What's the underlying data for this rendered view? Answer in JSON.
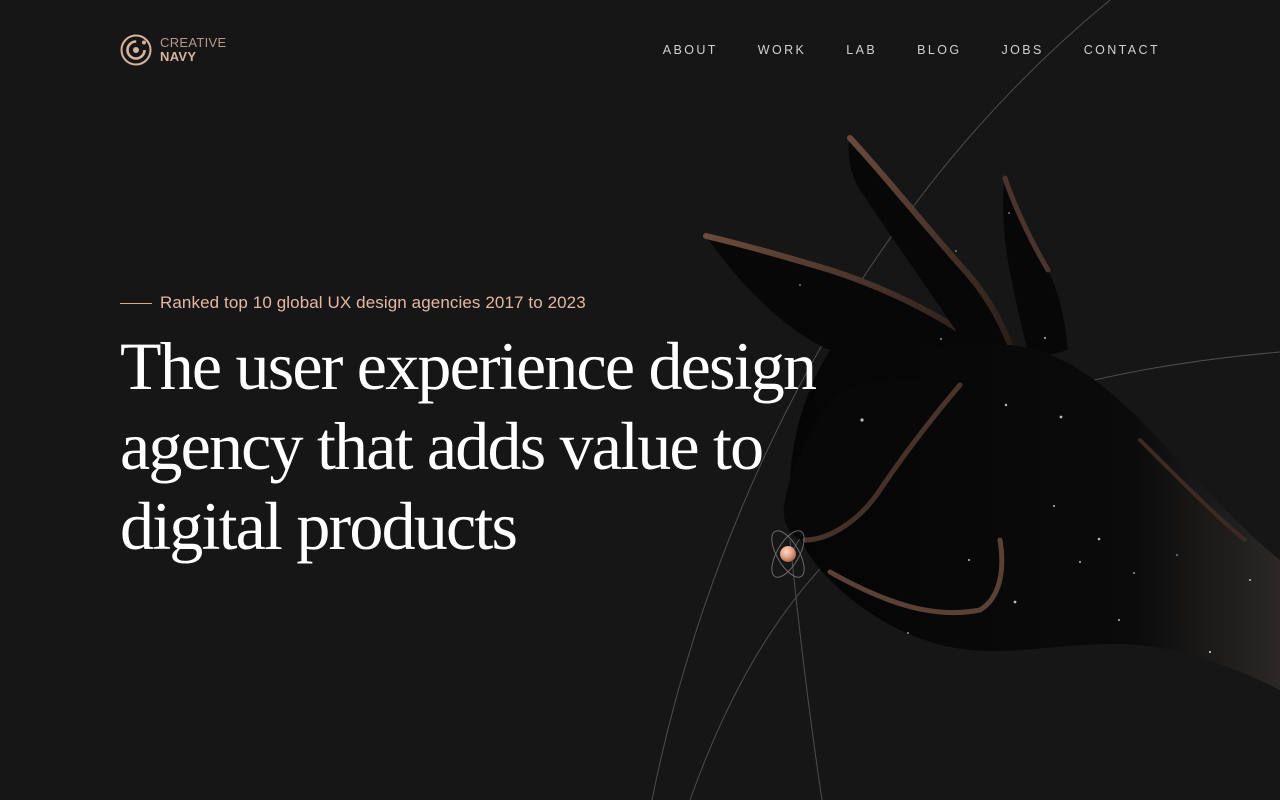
{
  "brand": {
    "logo_line1": "CREATIVE",
    "logo_line2": "NAVY"
  },
  "nav": {
    "items": [
      "ABOUT",
      "WORK",
      "LAB",
      "BLOG",
      "JOBS",
      "CONTACT"
    ]
  },
  "hero": {
    "eyebrow": "Ranked top 10 global UX design agencies 2017 to 2023",
    "headline_lines": [
      "The user experience design",
      "agency that adds value to",
      "digital products"
    ]
  },
  "colors": {
    "background": "#161616",
    "accent": "#e5b8a1",
    "nav_text": "#d0d0d0",
    "headline": "#ffffff"
  },
  "icons": {
    "logo": "creative-navy-logo-icon",
    "art": "cosmic-hand-illustration",
    "orb": "glowing-orb-icon"
  }
}
